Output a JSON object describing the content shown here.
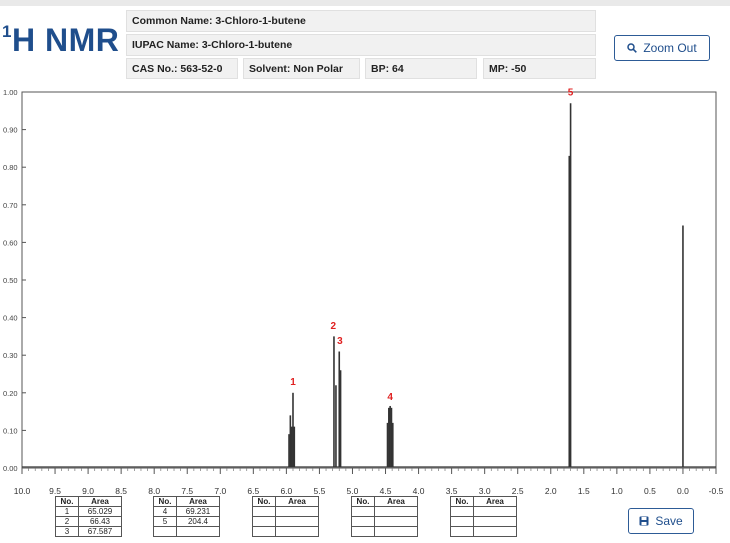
{
  "header": {
    "title_main": "H NMR",
    "title_sup": "1",
    "common_name": "Common Name: 3-Chloro-1-butene",
    "iupac_name": "IUPAC Name: 3-Chloro-1-butene",
    "cas": "CAS No.: 563-52-0",
    "solvent": "Solvent: Non Polar",
    "bp": "BP: 64",
    "mp": "MP: -50"
  },
  "toolbar": {
    "zoom_out_label": "Zoom Out",
    "save_label": "Save",
    "zoom_icon": "search-icon",
    "save_icon": "floppy-disk-icon"
  },
  "chart_data": {
    "type": "line",
    "xlabel": "",
    "ylabel": "",
    "xlim": [
      10.0,
      -0.5
    ],
    "ylim": [
      0.0,
      1.0
    ],
    "x_ticks": [
      "10.0",
      "9.5",
      "9.0",
      "8.5",
      "8.0",
      "7.5",
      "7.0",
      "6.5",
      "6.0",
      "5.5",
      "5.0",
      "4.5",
      "4.0",
      "3.5",
      "3.0",
      "2.5",
      "2.0",
      "1.5",
      "1.0",
      "0.5",
      "0.0",
      "-0.5"
    ],
    "y_ticks": [
      "0.00",
      "0.10",
      "0.20",
      "0.30",
      "0.40",
      "0.50",
      "0.60",
      "0.70",
      "0.80",
      "0.90",
      "1.00"
    ],
    "line_color": "#333333",
    "label_color": "#e02020",
    "peaks": [
      {
        "ppm": 5.96,
        "height": 0.09
      },
      {
        "ppm": 5.94,
        "height": 0.14
      },
      {
        "ppm": 5.92,
        "height": 0.11
      },
      {
        "ppm": 5.9,
        "height": 0.2
      },
      {
        "ppm": 5.88,
        "height": 0.11
      },
      {
        "ppm": 5.28,
        "height": 0.35
      },
      {
        "ppm": 5.25,
        "height": 0.22
      },
      {
        "ppm": 5.2,
        "height": 0.31
      },
      {
        "ppm": 5.18,
        "height": 0.26
      },
      {
        "ppm": 4.47,
        "height": 0.12
      },
      {
        "ppm": 4.45,
        "height": 0.16
      },
      {
        "ppm": 4.43,
        "height": 0.165
      },
      {
        "ppm": 4.41,
        "height": 0.16
      },
      {
        "ppm": 4.39,
        "height": 0.12
      },
      {
        "ppm": 1.72,
        "height": 0.83
      },
      {
        "ppm": 1.7,
        "height": 0.97
      },
      {
        "ppm": 0.0,
        "height": 0.645
      }
    ],
    "peak_labels": [
      {
        "label": "1",
        "ppm": 5.9,
        "y": 0.215
      },
      {
        "label": "2",
        "ppm": 5.29,
        "y": 0.365
      },
      {
        "label": "3",
        "ppm": 5.19,
        "y": 0.325
      },
      {
        "label": "4",
        "ppm": 4.43,
        "y": 0.175
      },
      {
        "label": "5",
        "ppm": 1.7,
        "y": 0.985
      }
    ]
  },
  "integration_tables": [
    {
      "header_no": "No.",
      "header_area": "Area",
      "rows": [
        [
          "1",
          "65.029"
        ],
        [
          "2",
          "66.43"
        ],
        [
          "3",
          "67.587"
        ]
      ]
    },
    {
      "header_no": "No.",
      "header_area": "Area",
      "rows": [
        [
          "4",
          "69.231"
        ],
        [
          "5",
          "204.4"
        ],
        [
          "",
          ""
        ]
      ]
    },
    {
      "header_no": "No.",
      "header_area": "Area",
      "rows": [
        [
          "",
          ""
        ],
        [
          "",
          ""
        ],
        [
          "",
          ""
        ]
      ]
    },
    {
      "header_no": "No.",
      "header_area": "Area",
      "rows": [
        [
          "",
          ""
        ],
        [
          "",
          ""
        ],
        [
          "",
          ""
        ]
      ]
    },
    {
      "header_no": "No.",
      "header_area": "Area",
      "rows": [
        [
          "",
          ""
        ],
        [
          "",
          ""
        ],
        [
          "",
          ""
        ]
      ]
    }
  ]
}
